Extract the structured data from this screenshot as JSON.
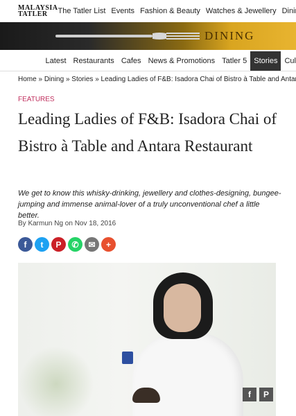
{
  "logo": {
    "line1": "MALAYSIA",
    "line2": "TATLER"
  },
  "topnav": [
    "The Tatler List",
    "Events",
    "Fashion & Beauty",
    "Watches & Jewellery",
    "Dining"
  ],
  "banner": {
    "title": "DINING"
  },
  "secnav": {
    "items": [
      "Latest",
      "Restaurants",
      "Cafes",
      "News & Promotions",
      "Tatler 5",
      "Stories",
      "Cul"
    ],
    "active": "Stories"
  },
  "breadcrumb": {
    "home": "Home",
    "dining": "Dining",
    "stories": "Stories",
    "sep": "»",
    "current": "Leading Ladies of F&B: Isadora Chai of Bistro à Table and Antara Rest"
  },
  "article": {
    "tag": "FEATURES",
    "title": "Leading Ladies of F&B: Isadora Chai of Bistro à Table and Antara Restaurant",
    "dek": "We get to know this whisky-drinking, jewellery and clothes-designing, bungee-jumping and immense animal-lover of a truly unconventional chef a little better.",
    "byline": "By Karmun Ng on Nov 18, 2016"
  },
  "share": [
    {
      "name": "facebook-icon",
      "glyph": "f",
      "color": "#3b5998"
    },
    {
      "name": "twitter-icon",
      "glyph": "t",
      "color": "#1da1f2"
    },
    {
      "name": "pinterest-icon",
      "glyph": "P",
      "color": "#cb2027"
    },
    {
      "name": "whatsapp-icon",
      "glyph": "✆",
      "color": "#25d366"
    },
    {
      "name": "email-icon",
      "glyph": "✉",
      "color": "#777777"
    },
    {
      "name": "more-icon",
      "glyph": "+",
      "color": "#e8502f"
    }
  ],
  "hero_buttons": {
    "facebook": "f",
    "pinterest": "P"
  }
}
